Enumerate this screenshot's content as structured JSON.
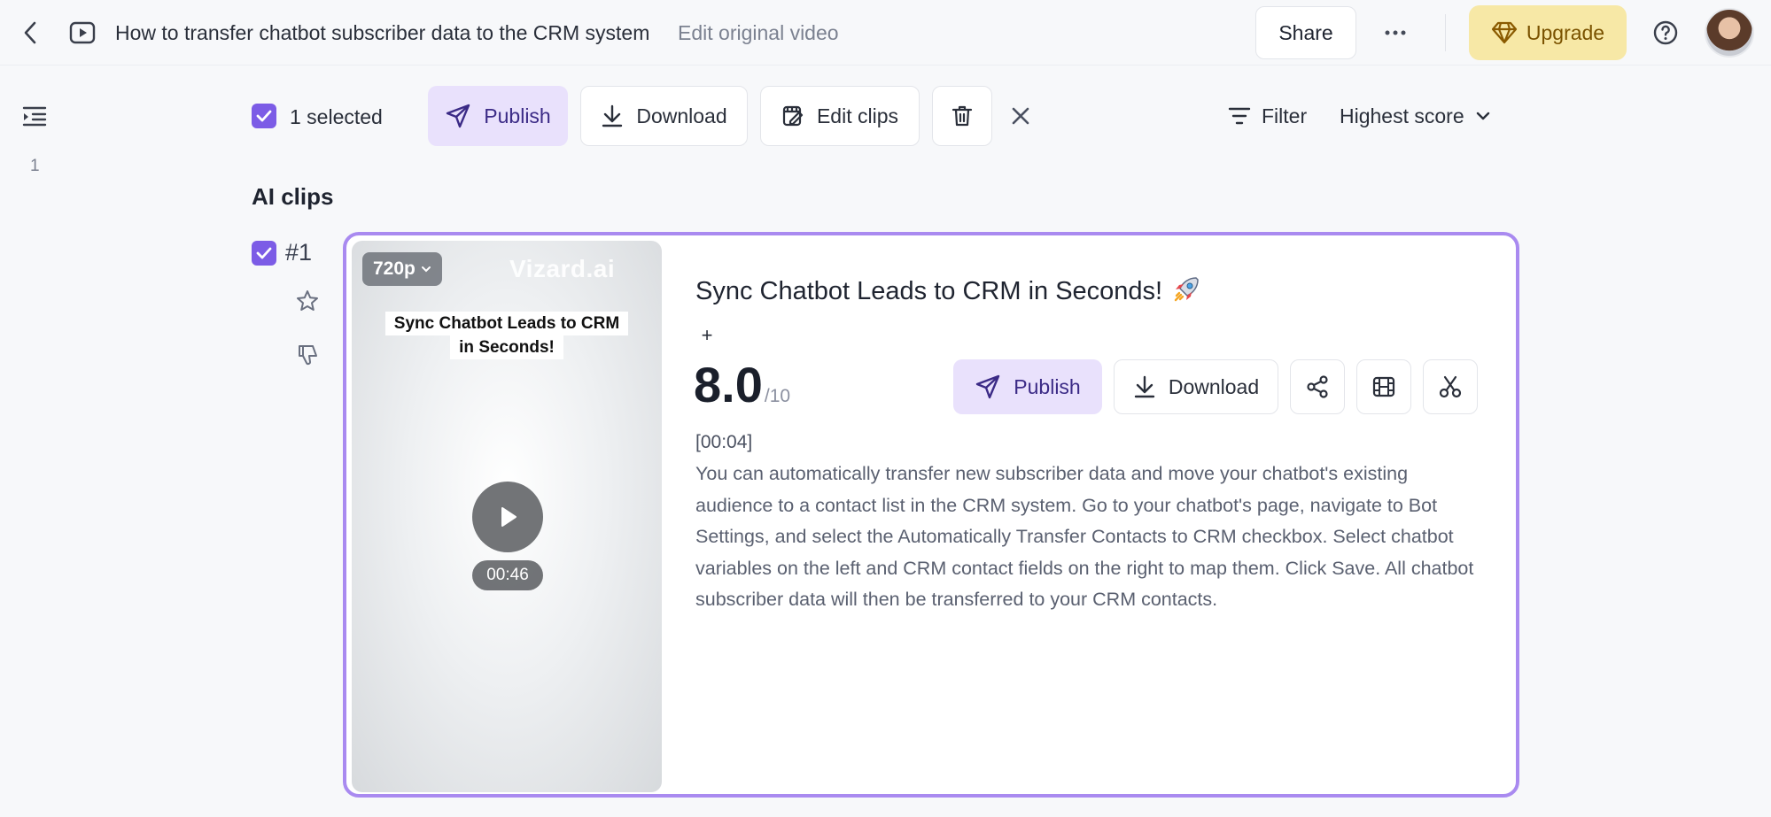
{
  "header": {
    "title": "How to transfer chatbot subscriber data to the CRM system",
    "edit_link": "Edit original video",
    "share_label": "Share",
    "more_label": "···",
    "upgrade_label": "Upgrade",
    "accent_color": "#f7e8a6"
  },
  "sidebar": {
    "outline_index": "1"
  },
  "toolbar": {
    "selected_text": "1 selected",
    "publish_label": "Publish",
    "download_label": "Download",
    "edit_clips_label": "Edit clips",
    "filter_label": "Filter",
    "sort_label": "Highest score"
  },
  "section": {
    "title": "AI clips"
  },
  "clips": [
    {
      "number": "#1",
      "resolution": "720p",
      "watermark": "Vizard.ai",
      "caption_line1": "Sync Chatbot Leads to CRM",
      "caption_line2": "in Seconds!",
      "duration": "00:46",
      "title": "Sync Chatbot Leads to CRM in Seconds!",
      "title_icon": "rocket-icon",
      "add_label": "+",
      "score": "8.0",
      "score_max": "/10",
      "publish_label": "Publish",
      "download_label": "Download",
      "timestamp": "[00:04]",
      "transcript": "You can automatically transfer new subscriber data and move your chatbot's existing audience to a contact list in the CRM system. Go to your chatbot's page, navigate to Bot Settings, and select the Automatically Transfer Contacts to CRM checkbox. Select chatbot variables on the left and CRM contact fields on the right to map them. Click Save. All chatbot subscriber data will then be transferred to your CRM contacts."
    }
  ],
  "colors": {
    "brand_purple": "#7c5ce6",
    "card_border": "#a98af0",
    "publish_bg": "#e9e1fc"
  }
}
